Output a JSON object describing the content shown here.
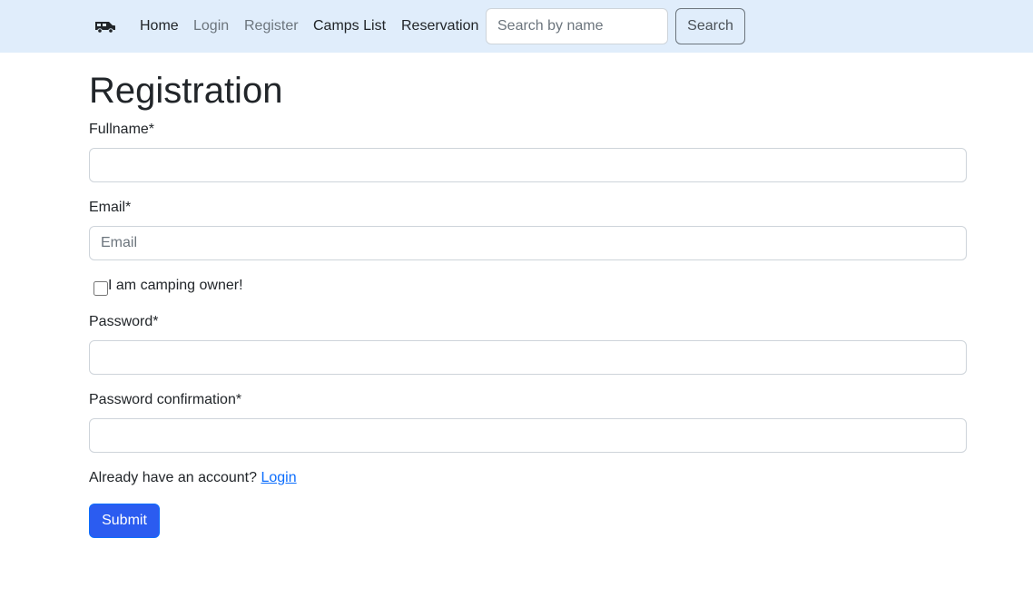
{
  "navbar": {
    "brand_icon": "camper-van-icon",
    "links": [
      {
        "label": "Home",
        "state": "active"
      },
      {
        "label": "Login",
        "state": "muted"
      },
      {
        "label": "Register",
        "state": "muted"
      },
      {
        "label": "Camps List",
        "state": "active"
      },
      {
        "label": "Reservation",
        "state": "active"
      }
    ],
    "search": {
      "placeholder": "Search by name",
      "value": "",
      "button_label": "Search"
    }
  },
  "form": {
    "title": "Registration",
    "fullname": {
      "label": "Fullname*",
      "placeholder": "",
      "value": ""
    },
    "email": {
      "label": "Email*",
      "placeholder": "Email",
      "value": ""
    },
    "owner_checkbox": {
      "label": "I am camping owner!",
      "checked": false
    },
    "password": {
      "label": "Password*",
      "placeholder": "",
      "value": ""
    },
    "password_confirmation": {
      "label": "Password confirmation*",
      "placeholder": "",
      "value": ""
    },
    "account_prompt": "Already have an account?",
    "login_link": "Login",
    "submit_label": "Submit"
  }
}
